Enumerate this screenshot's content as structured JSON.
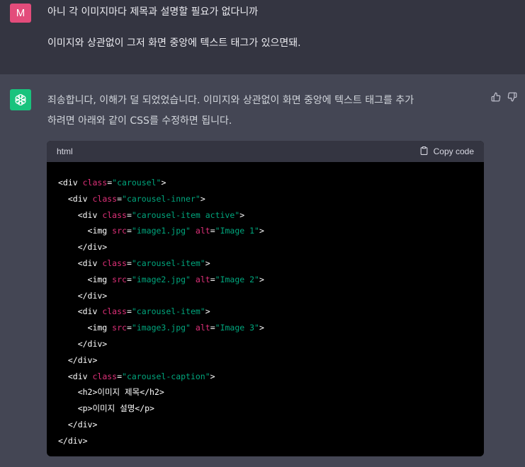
{
  "user": {
    "avatar_letter": "M",
    "line1": "아니 각 이미지마다 제목과 설명할 필요가 없다니까",
    "line2": "이미지와 상관없이 그저 화면 중앙에 텍스트 태그가 있으면돼."
  },
  "assistant": {
    "avatar_icon": "openai-logo-icon",
    "text_line1": "죄송합니다, 이해가 덜 되었었습니다. 이미지와 상관없이 화면 중앙에 텍스트 태그를 추가",
    "text_line2": "하려면 아래와 같이 CSS를 수정하면 됩니다.",
    "feedback": {
      "up_icon": "thumbs-up-icon",
      "down_icon": "thumbs-down-icon"
    }
  },
  "code_block": {
    "language": "html",
    "copy_label": "Copy code",
    "lines": [
      [
        {
          "t": "<div ",
          "c": "k"
        },
        {
          "t": "class",
          "c": "a"
        },
        {
          "t": "=",
          "c": "k"
        },
        {
          "t": "\"carousel\"",
          "c": "s"
        },
        {
          "t": ">",
          "c": "k"
        }
      ],
      [
        {
          "t": "  <div ",
          "c": "k"
        },
        {
          "t": "class",
          "c": "a"
        },
        {
          "t": "=",
          "c": "k"
        },
        {
          "t": "\"carousel-inner\"",
          "c": "s"
        },
        {
          "t": ">",
          "c": "k"
        }
      ],
      [
        {
          "t": "    <div ",
          "c": "k"
        },
        {
          "t": "class",
          "c": "a"
        },
        {
          "t": "=",
          "c": "k"
        },
        {
          "t": "\"carousel-item active\"",
          "c": "s"
        },
        {
          "t": ">",
          "c": "k"
        }
      ],
      [
        {
          "t": "      <img ",
          "c": "k"
        },
        {
          "t": "src",
          "c": "a"
        },
        {
          "t": "=",
          "c": "k"
        },
        {
          "t": "\"image1.jpg\"",
          "c": "s"
        },
        {
          "t": " ",
          "c": "k"
        },
        {
          "t": "alt",
          "c": "a"
        },
        {
          "t": "=",
          "c": "k"
        },
        {
          "t": "\"Image 1\"",
          "c": "s"
        },
        {
          "t": ">",
          "c": "k"
        }
      ],
      [
        {
          "t": "    </div>",
          "c": "k"
        }
      ],
      [
        {
          "t": "    <div ",
          "c": "k"
        },
        {
          "t": "class",
          "c": "a"
        },
        {
          "t": "=",
          "c": "k"
        },
        {
          "t": "\"carousel-item\"",
          "c": "s"
        },
        {
          "t": ">",
          "c": "k"
        }
      ],
      [
        {
          "t": "      <img ",
          "c": "k"
        },
        {
          "t": "src",
          "c": "a"
        },
        {
          "t": "=",
          "c": "k"
        },
        {
          "t": "\"image2.jpg\"",
          "c": "s"
        },
        {
          "t": " ",
          "c": "k"
        },
        {
          "t": "alt",
          "c": "a"
        },
        {
          "t": "=",
          "c": "k"
        },
        {
          "t": "\"Image 2\"",
          "c": "s"
        },
        {
          "t": ">",
          "c": "k"
        }
      ],
      [
        {
          "t": "    </div>",
          "c": "k"
        }
      ],
      [
        {
          "t": "    <div ",
          "c": "k"
        },
        {
          "t": "class",
          "c": "a"
        },
        {
          "t": "=",
          "c": "k"
        },
        {
          "t": "\"carousel-item\"",
          "c": "s"
        },
        {
          "t": ">",
          "c": "k"
        }
      ],
      [
        {
          "t": "      <img ",
          "c": "k"
        },
        {
          "t": "src",
          "c": "a"
        },
        {
          "t": "=",
          "c": "k"
        },
        {
          "t": "\"image3.jpg\"",
          "c": "s"
        },
        {
          "t": " ",
          "c": "k"
        },
        {
          "t": "alt",
          "c": "a"
        },
        {
          "t": "=",
          "c": "k"
        },
        {
          "t": "\"Image 3\"",
          "c": "s"
        },
        {
          "t": ">",
          "c": "k"
        }
      ],
      [
        {
          "t": "    </div>",
          "c": "k"
        }
      ],
      [
        {
          "t": "  </div>",
          "c": "k"
        }
      ],
      [
        {
          "t": "  <div ",
          "c": "k"
        },
        {
          "t": "class",
          "c": "a"
        },
        {
          "t": "=",
          "c": "k"
        },
        {
          "t": "\"carousel-caption\"",
          "c": "s"
        },
        {
          "t": ">",
          "c": "k"
        }
      ],
      [
        {
          "t": "    <h2>이미지 제목</h2>",
          "c": "k"
        }
      ],
      [
        {
          "t": "    <p>이미지 설명</p>",
          "c": "k"
        }
      ],
      [
        {
          "t": "  </div>",
          "c": "k"
        }
      ],
      [
        {
          "t": "</div>",
          "c": "k"
        }
      ]
    ]
  },
  "colors": {
    "user_bg": "#343541",
    "assistant_bg": "#444654",
    "user_avatar": "#e34c7b",
    "assistant_avatar": "#19c37d",
    "code_attr": "#df3079",
    "code_string": "#00a67d"
  }
}
